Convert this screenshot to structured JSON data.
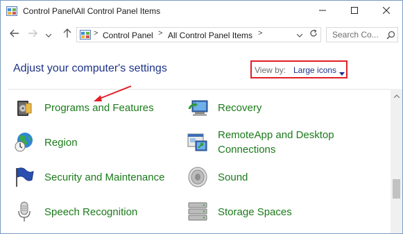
{
  "window": {
    "title": "Control Panel\\All Control Panel Items",
    "icon": "control-panel-icon",
    "buttons": {
      "minimize": "minimize-icon",
      "maximize": "maximize-icon",
      "close": "close-icon"
    }
  },
  "nav": {
    "back_icon": "arrow-left-icon",
    "forward_icon": "arrow-right-icon",
    "recent_icon": "chevron-down-icon",
    "up_icon": "arrow-up-icon"
  },
  "address": {
    "separator": ">",
    "crumbs": [
      "Control Panel",
      "All Control Panel Items"
    ]
  },
  "search": {
    "placeholder": "Search Co..."
  },
  "heading": {
    "title": "Adjust your computer's settings",
    "view_by_label": "View by:",
    "view_by_value": "Large icons"
  },
  "items": [
    {
      "label": "Programs and Features",
      "icon": "programs-features-icon"
    },
    {
      "label": "Recovery",
      "icon": "recovery-icon"
    },
    {
      "label": "Region",
      "icon": "region-globe-icon"
    },
    {
      "label": "RemoteApp and Desktop\nConnections",
      "icon": "remoteapp-icon"
    },
    {
      "label": "Security and Maintenance",
      "icon": "security-flag-icon"
    },
    {
      "label": "Sound",
      "icon": "speaker-icon"
    },
    {
      "label": "Speech Recognition",
      "icon": "microphone-icon"
    },
    {
      "label": "Storage Spaces",
      "icon": "storage-spaces-icon"
    }
  ],
  "colors": {
    "accent_link": "#1a7a1a",
    "title_blue": "#1e3287",
    "highlight_red": "#e01f26"
  }
}
